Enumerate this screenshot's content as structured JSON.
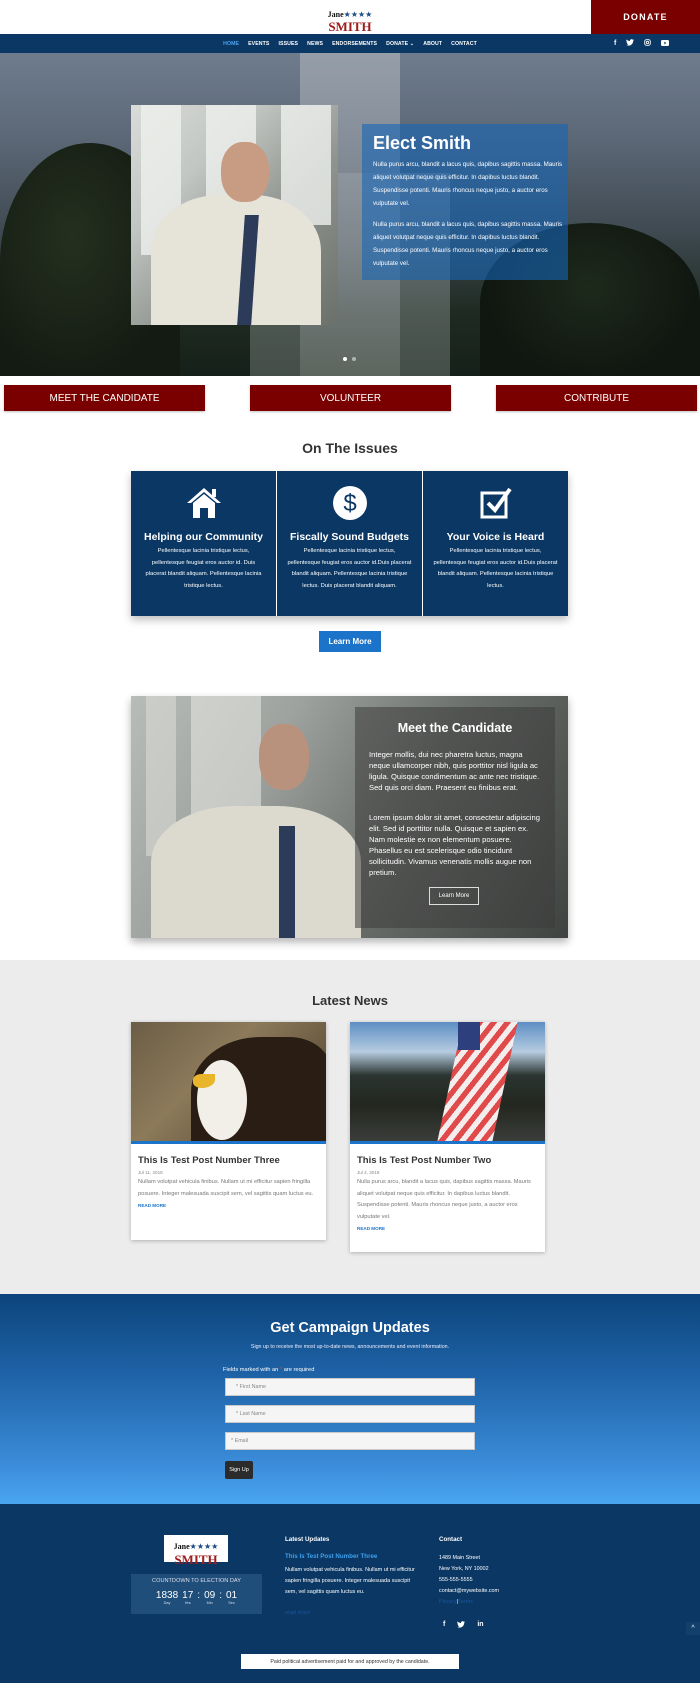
{
  "header": {
    "logo": {
      "first": "Jane",
      "stars": "★★★★",
      "last": "SMITH"
    },
    "donate_label": "DONATE",
    "nav": [
      {
        "label": "HOME",
        "active": true
      },
      {
        "label": "EVENTS"
      },
      {
        "label": "ISSUES"
      },
      {
        "label": "NEWS"
      },
      {
        "label": "ENDORSEMENTS"
      },
      {
        "label": "DONATE ⌄"
      },
      {
        "label": "ABOUT"
      },
      {
        "label": "CONTACT"
      }
    ],
    "social": [
      {
        "icon": "facebook-icon",
        "glyph": "f"
      },
      {
        "icon": "twitter-icon",
        "glyph": "🐦"
      },
      {
        "icon": "instagram-icon",
        "glyph": "◎"
      },
      {
        "icon": "youtube-icon",
        "glyph": "▶"
      }
    ]
  },
  "hero": {
    "title": "Elect Smith",
    "paragraphs": [
      "Nulla purus arcu, blandit a lacus quis, dapibus sagittis massa. Mauris aliquet volutpat neque quis efficitur. In dapibus luctus blandit. Suspendisse potenti. Mauris rhoncus neque justo, a auctor eros vulputate vel.",
      "Nulla purus arcu, blandit a lacus quis, dapibus sagittis massa. Mauris aliquet volutpat neque quis efficitur. In dapibus luctus blandit. Suspendisse potenti. Mauris rhoncus neque justo, a auctor eros vulputate vel."
    ],
    "slides": 2,
    "active_slide": 1
  },
  "cta": [
    "MEET THE CANDIDATE",
    "VOLUNTEER",
    "CONTRIBUTE"
  ],
  "issues": {
    "title": "On The Issues",
    "items": [
      {
        "icon": "home-icon",
        "title": "Helping our Community",
        "text": "Pellentesque lacinia tristique lectus, pellentesque feugiat eros auctor id. Duis placerat blandit aliquam. Pellentesque lacinia tristique lectus."
      },
      {
        "icon": "dollar-icon",
        "title": "Fiscally Sound Budgets",
        "text": "Pellentesque lacinia tristique lectus, pellentesque feugiat eros auctor id.Duis placerat blandit aliquam. Pellentesque lacinia tristique lectus. Duis placerat blandit aliquam."
      },
      {
        "icon": "checkbox-icon",
        "title": "Your Voice is Heard",
        "text": "Pellentesque lacinia tristique lectus, pellentesque feugiat eros auctor id.Duis placerat blandit aliquam. Pellentesque lacinia tristique lectus."
      }
    ],
    "button": "Learn More"
  },
  "meet": {
    "title": "Meet the Candidate",
    "paragraphs": [
      "Integer mollis, dui nec pharetra luctus, magna neque ullamcorper nibh, quis porttitor nisl ligula ac ligula. Quisque condimentum ac ante nec tristique. Sed quis orci diam. Praesent eu finibus erat.",
      "Lorem ipsum dolor sit amet, consectetur adipiscing elit. Sed id porttitor nulla. Quisque et sapien ex. Nam molestie ex non elementum posuere. Phasellus eu est scelerisque odio tincidunt sollicitudin. Vivamus venenatis mollis augue non pretium."
    ],
    "button": "Learn More"
  },
  "news": {
    "title": "Latest News",
    "posts": [
      {
        "title": "This Is Test Post Number Three",
        "date": "Jul 11, 2018",
        "excerpt": "Nullam volutpat vehicula finibus. Nullam ut mi efficitur sapien fringilla posuere. Integer malesuada suscipit sem, vel sagittis quam luctus eu.",
        "read_more": "READ MORE"
      },
      {
        "title": "This Is Test Post Number Two",
        "date": "Jul 4, 2018",
        "excerpt": "Nulla purus arcu, blandit a lacus quis, dapibus sagittis massa. Mauris aliquet volutpat neque quis efficitur. In dapibus luctus blandit. Suspendisse potenti. Mauris rhoncus neque justo, a auctor eros vulputate vel.",
        "read_more": "READ MORE"
      }
    ]
  },
  "updates": {
    "title": "Get Campaign Updates",
    "subtitle": "Sign up to receive the most up-to-date news, announcements and event information.",
    "required_note_prefix": "Fields marked with an ",
    "required_note_star": "*",
    "required_note_suffix": " are required",
    "fields": [
      {
        "placeholder": "* First Name",
        "value": ""
      },
      {
        "placeholder": "* Last Name",
        "value": ""
      },
      {
        "placeholder": "* Email",
        "value": ""
      }
    ],
    "button": "Sign Up"
  },
  "footer": {
    "countdown": {
      "label": "COUNTDOWN TO ELECTION DAY",
      "units": [
        {
          "value": "1838",
          "label": "Day"
        },
        {
          "value": "17",
          "label": "Hrs"
        },
        {
          "value": "09",
          "label": "Min"
        },
        {
          "value": "01",
          "label": "Sec"
        }
      ]
    },
    "latest": {
      "title": "Latest Updates",
      "post_title": "This Is Test Post Number Three",
      "excerpt": "Nullam volutpat vehicula finibus. Nullam ut mi efficitur sapien fringilla posuere. Integer malesuada suscipit sem, vel sagittis quam luctus eu.",
      "read_more": "read more"
    },
    "contact": {
      "title": "Contact",
      "lines": [
        "1489 Main Street",
        "New York, NY 10002",
        "555-555-5555",
        "contact@mywebsite.com"
      ],
      "privacy": "Privacy",
      "separator": "|",
      "terms": "Terms"
    },
    "social": [
      {
        "icon": "facebook-icon",
        "glyph": "f"
      },
      {
        "icon": "twitter-icon",
        "glyph": "🐦"
      },
      {
        "icon": "linkedin-icon",
        "glyph": "in"
      }
    ],
    "to_top": "^",
    "disclaimer": "Paid political advertisement paid for and approved by the candidate."
  },
  "colors": {
    "navy": "#0a3764",
    "crimson": "#7a0000",
    "accent_blue": "#1b74c9",
    "nav_active": "#4aa3ef"
  }
}
